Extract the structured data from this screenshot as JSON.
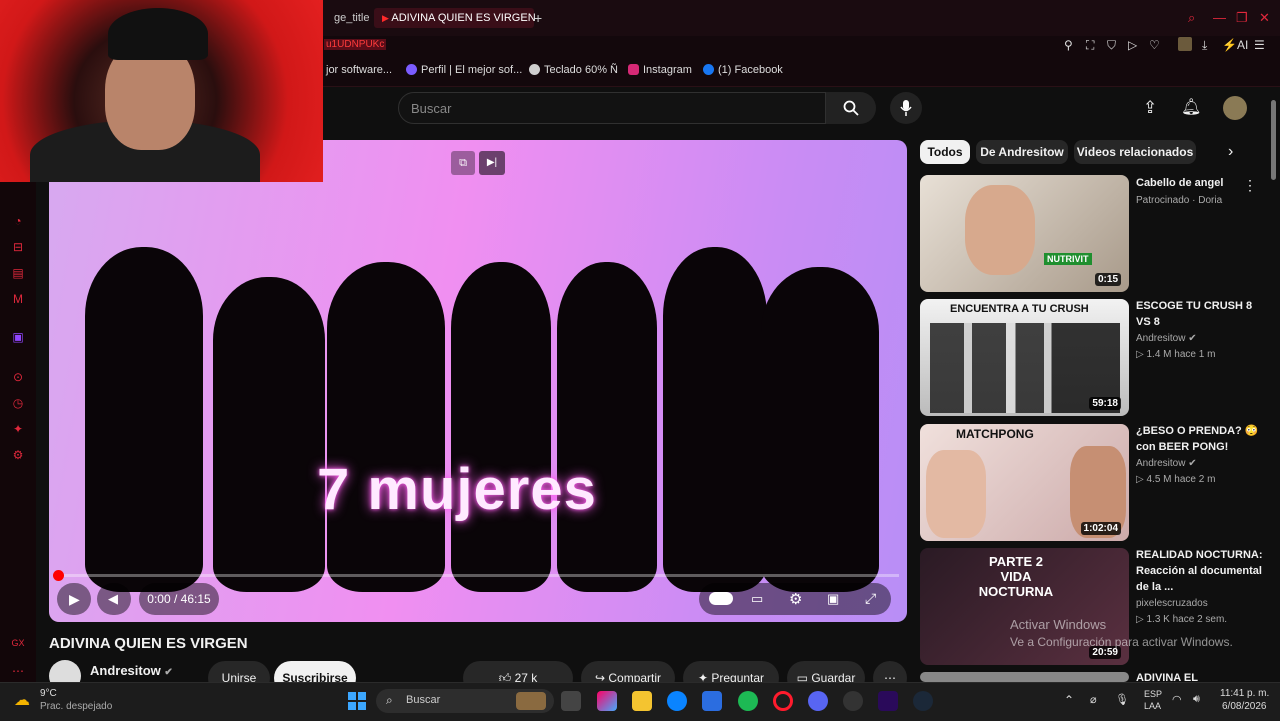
{
  "browser": {
    "tabs": [
      {
        "label": "ge_title",
        "active": false
      },
      {
        "label": "ADIVINA QUIEN ES VIRGEN",
        "active": true
      }
    ],
    "new_tab": "+",
    "address_fragment": "u1UDNPUKc",
    "bookmarks": [
      {
        "label": "jor software...",
        "color": "#444"
      },
      {
        "label": "Perfil | El mejor sof...",
        "color": "#7b5cff"
      },
      {
        "label": "Teclado 60% Ñ",
        "color": "#cfcfcf"
      },
      {
        "label": "Instagram",
        "color": "#d62976"
      },
      {
        "label": "(1) Facebook",
        "color": "#1877f2"
      }
    ],
    "toolbar_ai": "AI"
  },
  "youtube": {
    "search_placeholder": "Buscar",
    "player": {
      "overlay_text": "7 mujeres",
      "time": "0:00 / 46:15",
      "progress": 0.0
    },
    "video_title": "ADIVINA QUIEN ES VIRGEN",
    "channel": "Andresitow",
    "join": "Unirse",
    "subscribe": "Suscribirse",
    "likes": "27 k",
    "share": "Compartir",
    "ask": "Preguntar",
    "save": "Guardar",
    "chips": [
      "Todos",
      "De Andresitow",
      "Videos relacionados"
    ],
    "sidebar": [
      {
        "title": "Cabello de angel",
        "meta1": "Patrocinado · Doria",
        "meta2": "",
        "duration": "0:15",
        "thumb": "#c9b7a7"
      },
      {
        "title": "ESCOGE TU CRUSH 8 VS 8",
        "meta1": "Andresitow",
        "meta2": "1.4 M  hace 1 m",
        "duration": "59:18",
        "thumb": "#d9d9d9"
      },
      {
        "title": "¿BESO O PRENDA? 😳 con BEER PONG!",
        "meta1": "Andresitow",
        "meta2": "4.5 M  hace 2 m",
        "duration": "1:02:04",
        "thumb": "#e9d8d0"
      },
      {
        "title": "REALIDAD NOCTURNA: Reacción al documental de la ...",
        "meta1": "pixelescruzados",
        "meta2": "1.3 K  hace 2 sem.",
        "duration": "20:59",
        "thumb": "#3a2a36"
      },
      {
        "title": "ADIVINA EL",
        "meta1": "",
        "meta2": "",
        "duration": "",
        "thumb": "#888"
      }
    ],
    "thumb_texts": [
      "NUTRIVIT",
      "ENCUENTRA A TU CRUSH",
      "MATCHPONG",
      "PARTE 2 VIDA NOCTURNA"
    ]
  },
  "windows": {
    "activation_line1": "Activar Windows",
    "activation_line2": "Ve a Configuración para activar Windows.",
    "weather_temp": "9°C",
    "weather_desc": "Prac. despejado",
    "search": "Buscar",
    "lang1": "ESP",
    "lang2": "LAA",
    "clock_time": "11:41 p. m.",
    "clock_date": "6/08/2026"
  }
}
